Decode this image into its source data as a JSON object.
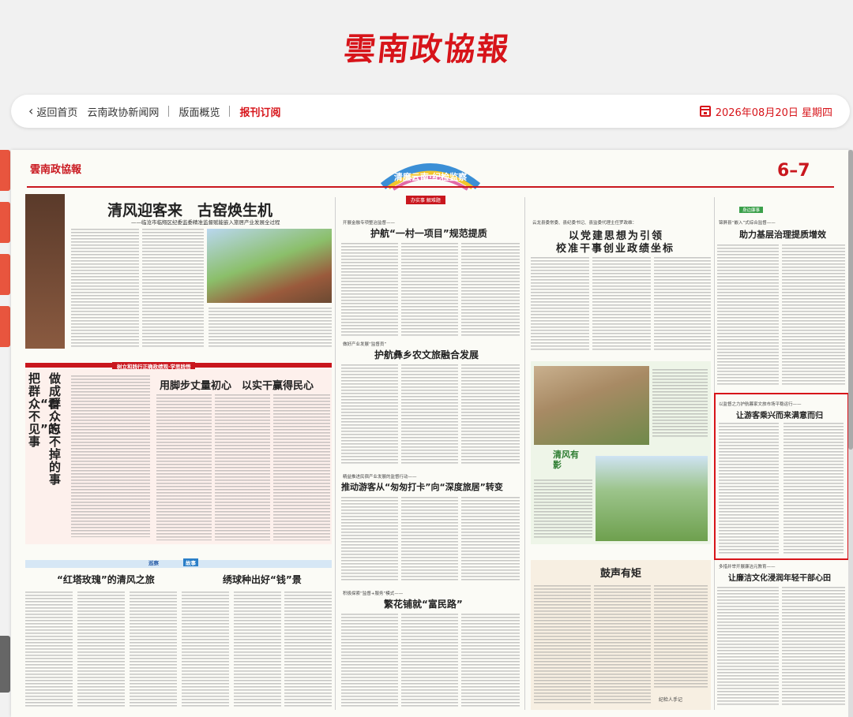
{
  "masthead": {
    "logo_text": "雲南政協報"
  },
  "nav": {
    "back_label": "返回首页",
    "site_link": "云南政协新闻网",
    "layout_link": "版面概览",
    "subscribe_link": "报刊订阅",
    "date": "2026年08月20日 星期四"
  },
  "paper": {
    "logo": "雲南政協報",
    "page_number": "6–7",
    "banner_title": "清廉云南·纪检监察",
    "banner_sub": "之窗",
    "section_tag": "办实事 解难题",
    "col1": {
      "headline": "清风迎客来　古窑焕生机",
      "sub": "——临沧市临翔区纪委监委精准监督赋能嵌入旅居产业发展全过程",
      "strip_title": "树立和践行正确政绩观·学思践悟",
      "vert_headline_1": "做成群众忘不掉的事",
      "vert_headline_2": "把群众“看不见”的事",
      "essay_headline": "用脚步丈量初心　以实干赢得民心",
      "tag_left": "巡察",
      "tag_right": "故事",
      "story1_headline": "“红塔玫瑰”的清风之旅",
      "story2_headline": "绣球种出好“钱”景"
    },
    "col2": {
      "kicker1": "开展金融专项整治监督——",
      "headline1": "护航“一村一项目”规范提质",
      "kicker2": "做好产业发展“监督员”",
      "headline2": "护航彝乡农文旅融合发展",
      "kicker3": "精益推进民宿产业发展的监督行动——",
      "headline3": "推动游客从“匆匆打卡”向“深度旅居”转变",
      "kicker4": "积极探索“监督+服务”模式——",
      "headline4": "繁花铺就“富民路”"
    },
    "col3": {
      "kicker": "云龙县委常委、县纪委书记、县监委代理主任罗政维：",
      "headline_1": "以党建思想为引领",
      "headline_2": "校准干事创业政绩坐标",
      "photo_tag": "清风有影",
      "bottom_headline": "鼓声有矩",
      "bottom_badge": "纪检人手记"
    },
    "col4": {
      "tag": "身边廉事",
      "kicker1": "锦屏县“嵌入”式综合监督——",
      "headline1": "助力基层治理提质增效",
      "box_kicker": "以监督之力护航暮家文旅市场平稳运行——",
      "box_headline": "让游客乘兴而来满意而归",
      "kicker3": "多措并举开展廉洁元教育——",
      "headline3": "让廉洁文化浸润年轻干部心田"
    }
  },
  "colors": {
    "brand_red": "#d7141a",
    "paper_bg": "#fbfbf6"
  },
  "icons": [
    "chevron-left-icon",
    "calendar-icon"
  ]
}
